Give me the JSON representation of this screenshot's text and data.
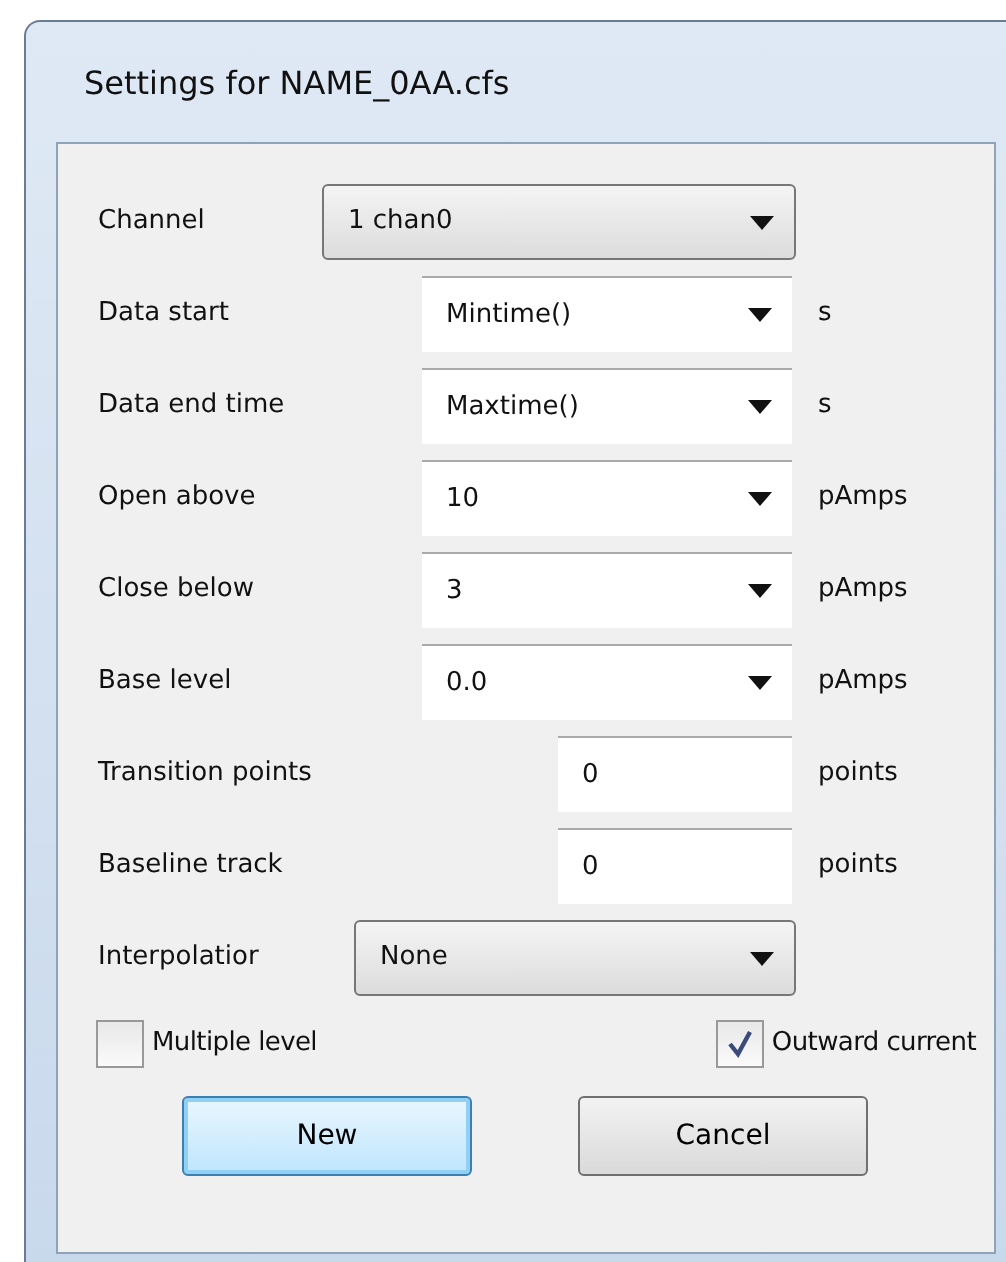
{
  "window": {
    "title": "Settings for NAME_0AA.cfs"
  },
  "fields": [
    {
      "kind": "combo",
      "label": "Channel",
      "value": "1 chan0"
    },
    {
      "kind": "dropdown",
      "label": "Data start",
      "value": "Mintime()",
      "unit": "s"
    },
    {
      "kind": "dropdown",
      "label": "Data end time",
      "value": "Maxtime()",
      "unit": "s"
    },
    {
      "kind": "dropdown",
      "label": "Open above",
      "value": "10",
      "unit": "pAmps"
    },
    {
      "kind": "dropdown",
      "label": "Close below",
      "value": "3",
      "unit": "pAmps"
    },
    {
      "kind": "dropdown",
      "label": "Base level",
      "value": "0.0",
      "unit": "pAmps"
    },
    {
      "kind": "number",
      "label": "Transition points",
      "value": "0",
      "unit": "points"
    },
    {
      "kind": "number",
      "label": "Baseline track",
      "value": "0",
      "unit": "points"
    },
    {
      "kind": "combo",
      "label": "Interpolatior",
      "value": "None"
    }
  ],
  "checkboxes": [
    {
      "label": "Multiple level",
      "checked": false
    },
    {
      "label": "Outward current",
      "checked": true
    }
  ],
  "buttons": [
    {
      "label": "New",
      "default": true
    },
    {
      "label": "Cancel",
      "default": false
    }
  ]
}
